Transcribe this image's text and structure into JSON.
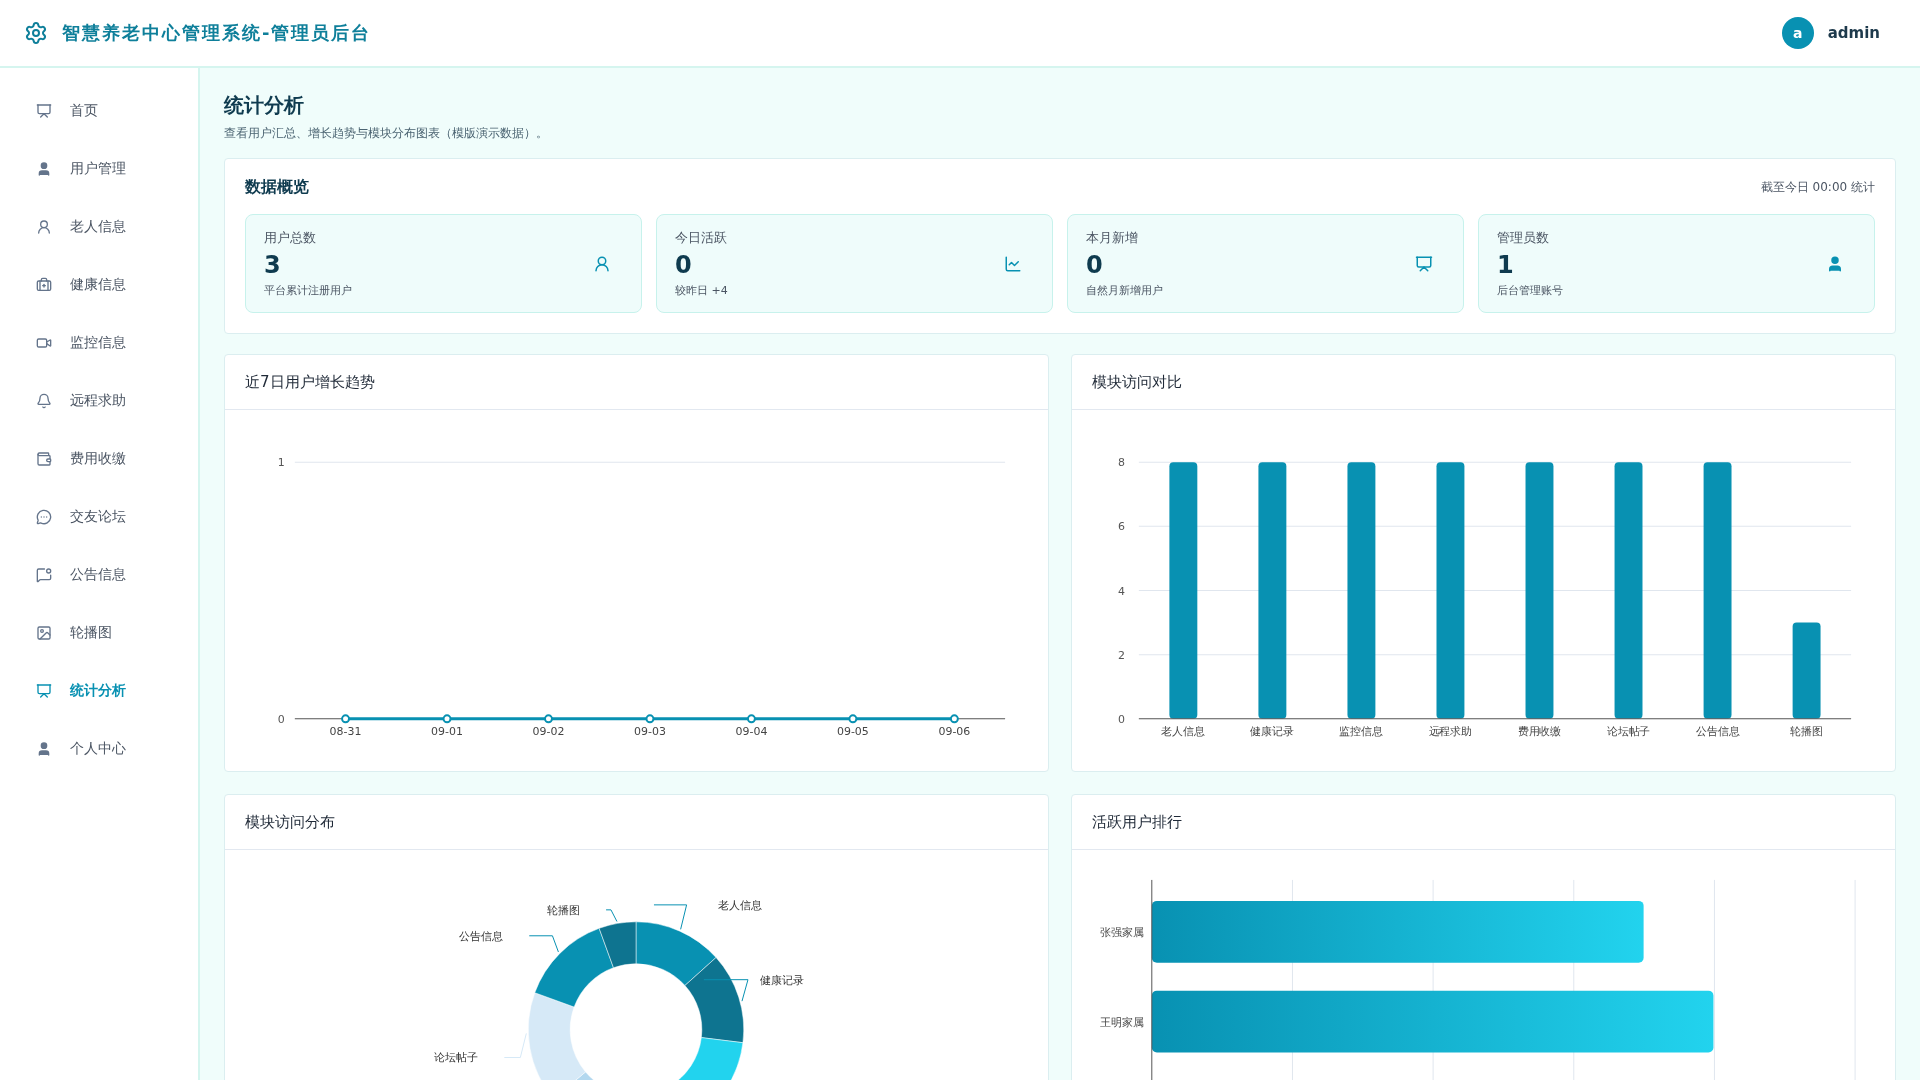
{
  "header": {
    "title": "智慧养老中心管理系统-管理员后台",
    "avatar_letter": "a",
    "user": "admin"
  },
  "sidebar": {
    "items": [
      {
        "label": "首页",
        "selected": false
      },
      {
        "label": "用户管理",
        "selected": false
      },
      {
        "label": "老人信息",
        "selected": false
      },
      {
        "label": "健康信息",
        "selected": false
      },
      {
        "label": "监控信息",
        "selected": false
      },
      {
        "label": "远程求助",
        "selected": false
      },
      {
        "label": "费用收缴",
        "selected": false
      },
      {
        "label": "交友论坛",
        "selected": false
      },
      {
        "label": "公告信息",
        "selected": false
      },
      {
        "label": "轮播图",
        "selected": false
      },
      {
        "label": "统计分析",
        "selected": true
      },
      {
        "label": "个人中心",
        "selected": false
      }
    ]
  },
  "page": {
    "title": "统计分析",
    "subtitle": "查看用户汇总、增长趋势与模块分布图表（模版演示数据）。"
  },
  "overview": {
    "title": "数据概览",
    "note": "截至今日 00:00 统计",
    "stats": [
      {
        "label": "用户总数",
        "value": "3",
        "note": "平台累计注册用户"
      },
      {
        "label": "今日活跃",
        "value": "0",
        "note": "较昨日 +4"
      },
      {
        "label": "本月新增",
        "value": "0",
        "note": "自然月新增用户"
      },
      {
        "label": "管理员数",
        "value": "1",
        "note": "后台管理账号"
      }
    ]
  },
  "growth_chart": {
    "title": "近7日用户增长趋势",
    "chart_data": {
      "type": "line",
      "categories": [
        "08-31",
        "09-01",
        "09-02",
        "09-03",
        "09-04",
        "09-05",
        "09-06"
      ],
      "series": [
        {
          "color": "#0891b2",
          "marker": true,
          "values": [
            0,
            0,
            0,
            0,
            0,
            0,
            0
          ]
        }
      ],
      "ylim": [
        0,
        1
      ],
      "yticks": [
        0,
        1
      ],
      "grid": true
    }
  },
  "module_chart": {
    "title": "模块访问对比",
    "chart_data": {
      "type": "bar",
      "categories": [
        "老人信息",
        "健康记录",
        "监控信息",
        "远程求助",
        "费用收缴",
        "论坛帖子",
        "公告信息",
        "轮播图"
      ],
      "series": [
        {
          "color": "#0891b2",
          "values": [
            8,
            8,
            8,
            8,
            8,
            8,
            8,
            3
          ]
        }
      ],
      "ylim": [
        0,
        8
      ],
      "yticks": [
        0,
        2,
        4,
        6,
        8
      ],
      "grid": true
    }
  },
  "distribution": {
    "title": "模块访问分布",
    "labels": [
      "老人信息",
      "健康记录",
      "论坛帖子",
      "公告信息",
      "轮播图"
    ]
  },
  "ranking": {
    "title": "活跃用户排行",
    "users": [
      "张强家属",
      "王明家属"
    ]
  }
}
